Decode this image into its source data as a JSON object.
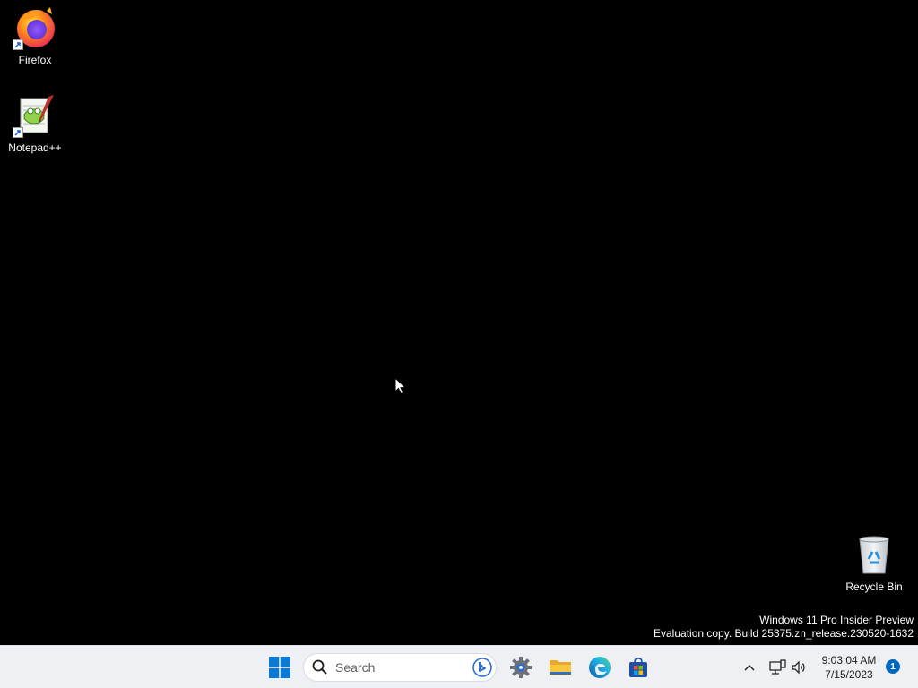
{
  "desktop": {
    "icons": [
      {
        "label": "Firefox"
      },
      {
        "label": "Notepad++"
      },
      {
        "label": "Recycle Bin"
      }
    ],
    "watermark": {
      "line1": "Windows 11 Pro Insider Preview",
      "line2": "Evaluation copy. Build 25375.zn_release.230520-1632"
    }
  },
  "taskbar": {
    "search_placeholder": "Search",
    "pinned": [
      {
        "icon": "windows-start-icon"
      },
      {
        "icon": "bing-icon"
      },
      {
        "icon": "settings-gear-icon"
      },
      {
        "icon": "file-explorer-icon"
      },
      {
        "icon": "edge-icon"
      },
      {
        "icon": "microsoft-store-icon"
      }
    ],
    "tray": {
      "time": "9:03:04 AM",
      "date": "7/15/2023",
      "notification_count": "1"
    }
  },
  "colors": {
    "desktop_bg": "#000000",
    "taskbar_bg": "#eef0f3",
    "accent": "#0067c0"
  }
}
